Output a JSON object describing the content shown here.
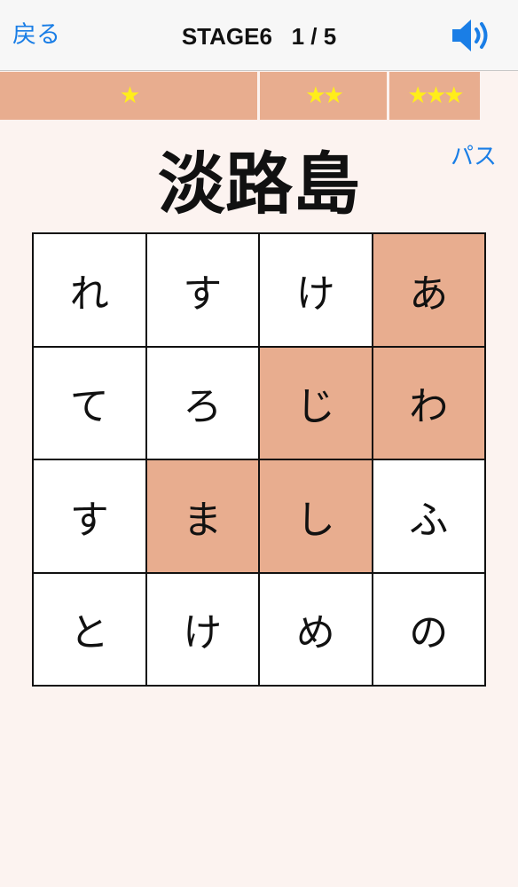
{
  "nav": {
    "back_label": "戻る",
    "title": "STAGE6   1 / 5",
    "sound_icon": "speaker-volume-icon"
  },
  "stars": [
    {
      "label": "★"
    },
    {
      "label": "★★"
    },
    {
      "label": "★★★"
    }
  ],
  "pass_label": "パス",
  "word": "淡路島",
  "grid": {
    "cells": [
      {
        "char": "れ",
        "selected": false
      },
      {
        "char": "す",
        "selected": false
      },
      {
        "char": "け",
        "selected": false
      },
      {
        "char": "あ",
        "selected": true
      },
      {
        "char": "て",
        "selected": false
      },
      {
        "char": "ろ",
        "selected": false
      },
      {
        "char": "じ",
        "selected": true
      },
      {
        "char": "わ",
        "selected": true
      },
      {
        "char": "す",
        "selected": false
      },
      {
        "char": "ま",
        "selected": true
      },
      {
        "char": "し",
        "selected": true
      },
      {
        "char": "ふ",
        "selected": false
      },
      {
        "char": "と",
        "selected": false
      },
      {
        "char": "け",
        "selected": false
      },
      {
        "char": "め",
        "selected": false
      },
      {
        "char": "の",
        "selected": false
      }
    ]
  },
  "colors": {
    "accent": "#1a7ee6",
    "selected_cell": "#e8ad8f",
    "star": "#ffee1a",
    "background": "#fcf3f0"
  }
}
